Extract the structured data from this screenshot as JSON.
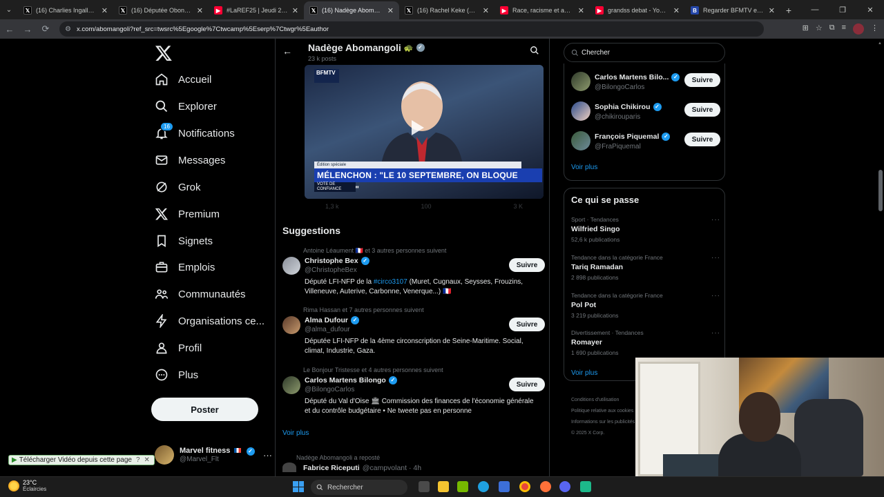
{
  "browser": {
    "tabs": [
      {
        "title": "(16) Charlies Ingalls Le Vrai",
        "favicon": "x",
        "active": false
      },
      {
        "title": "(16) Députée Obono (@Dan",
        "favicon": "x",
        "active": false
      },
      {
        "title": "#LaREF25 | Jeudi 28 août",
        "favicon": "yt",
        "active": false
      },
      {
        "title": "(16) Nadège Abomangoli",
        "favicon": "x",
        "active": true
      },
      {
        "title": "(16) Rachel Keke (@KekeR",
        "favicon": "x",
        "active": false
      },
      {
        "title": "Race, racisme et antiracisme",
        "favicon": "yt",
        "active": false
      },
      {
        "title": "grandss debat - YouTube",
        "favicon": "yt",
        "active": false
      },
      {
        "title": "Regarder BFMTV en direct",
        "favicon": "bfm",
        "active": false
      }
    ],
    "url": "x.com/abomangoli?ref_src=twsrc%5Egoogle%7Ctwcamp%5Eserp%7Ctwgr%5Eauthor"
  },
  "nav": {
    "items": [
      {
        "label": "Accueil",
        "icon": "home-icon"
      },
      {
        "label": "Explorer",
        "icon": "search-icon"
      },
      {
        "label": "Notifications",
        "icon": "bell-icon",
        "badge": "16"
      },
      {
        "label": "Messages",
        "icon": "mail-icon"
      },
      {
        "label": "Grok",
        "icon": "grok-icon"
      },
      {
        "label": "Premium",
        "icon": "x-icon"
      },
      {
        "label": "Signets",
        "icon": "bookmark-icon"
      },
      {
        "label": "Emplois",
        "icon": "briefcase-icon"
      },
      {
        "label": "Communautés",
        "icon": "people-icon"
      },
      {
        "label": "Organisations ce...",
        "icon": "lightning-icon"
      },
      {
        "label": "Profil",
        "icon": "person-icon"
      },
      {
        "label": "Plus",
        "icon": "more-circle-icon"
      }
    ],
    "post_label": "Poster",
    "account": {
      "name": "Marvel fitness",
      "handle": "@Marvel_Flt"
    }
  },
  "extension": {
    "download_label": "Télécharger Vidéo depuis cette page",
    "help": "?"
  },
  "profile": {
    "name": "Nadège Abomangoli",
    "posts": "23 k posts"
  },
  "video": {
    "channel_logo": "BFMTV",
    "headline": "MÉLENCHON : \"LE 10 SEPTEMBRE, ON BLOQUE MACRON\"",
    "strap": "VOTE DE CONFIANCE",
    "ticker": "Édition spéciale"
  },
  "tweet_actions": {
    "comments": "1,3 k",
    "retweets": "100",
    "views": "3 K"
  },
  "suggestions": {
    "title": "Suggestions",
    "items": [
      {
        "context": "Antoine Léaument 🇫🇷 et 3 autres personnes suivent",
        "name": "Christophe Bex",
        "handle": "@ChristopheBex",
        "bio_pre": "Député LFI-NFP de la ",
        "bio_link": "#circo3107",
        "bio_post": " (Muret, Cugnaux, Seysses, Frouzins, Villeneuve, Auterive, Carbonne, Venerque...) 🇫🇷",
        "follow": "Suivre"
      },
      {
        "context": "Rima Hassan et 7 autres personnes suivent",
        "name": "Alma Dufour",
        "handle": "@alma_dufour",
        "bio_pre": "Députée LFI-NFP de la 4ème circonscription de Seine-Maritime. Social, climat, Industrie, Gaza.",
        "bio_link": "",
        "bio_post": "",
        "follow": "Suivre"
      },
      {
        "context": "Le Bonjour Tristesse et 4 autres personnes suivent",
        "name": "Carlos Martens Bilongo",
        "handle": "@BilongoCarlos",
        "bio_pre": "Député du Val d'Oise 🏛 Commission des finances de l'économie générale et du contrôle budgétaire • Ne tweete pas en personne",
        "bio_link": "",
        "bio_post": "",
        "follow": "Suivre"
      }
    ],
    "voir_plus": "Voir plus"
  },
  "feed_bottom": {
    "repost_context": "Nadège Abomangoli a reposté",
    "name": "Fabrice Riceputi",
    "handle": "@campvolant · 4h"
  },
  "search": {
    "placeholder": "Chercher"
  },
  "who_to_follow": {
    "items": [
      {
        "name": "Carlos Martens Bilo...",
        "handle": "@BilongoCarlos",
        "follow": "Suivre"
      },
      {
        "name": "Sophia Chikirou",
        "handle": "@chikirouparis",
        "follow": "Suivre"
      },
      {
        "name": "François Piquemal",
        "handle": "@FraPiquemal",
        "follow": "Suivre"
      }
    ],
    "voir_plus": "Voir plus"
  },
  "trends": {
    "title": "Ce qui se passe",
    "items": [
      {
        "category": "Sport · Tendances",
        "name": "Wilfried Singo",
        "count": "52,6 k publications"
      },
      {
        "category": "Tendance dans la catégorie France",
        "name": "Tariq Ramadan",
        "count": "2 898 publications"
      },
      {
        "category": "Tendance dans la catégorie France",
        "name": "Pol Pot",
        "count": "3 219 publications"
      },
      {
        "category": "Divertissement · Tendances",
        "name": "Romayer",
        "count": "1 690 publications"
      }
    ],
    "voir_plus": "Voir plus"
  },
  "footer": {
    "links": [
      "Conditions d'utilisation",
      "Politique relative aux cookies",
      "Informations sur les publicités",
      "© 2025 X Corp."
    ]
  },
  "taskbar": {
    "temp": "23°C",
    "condition": "Éclaircies",
    "search_label": "Rechercher"
  }
}
